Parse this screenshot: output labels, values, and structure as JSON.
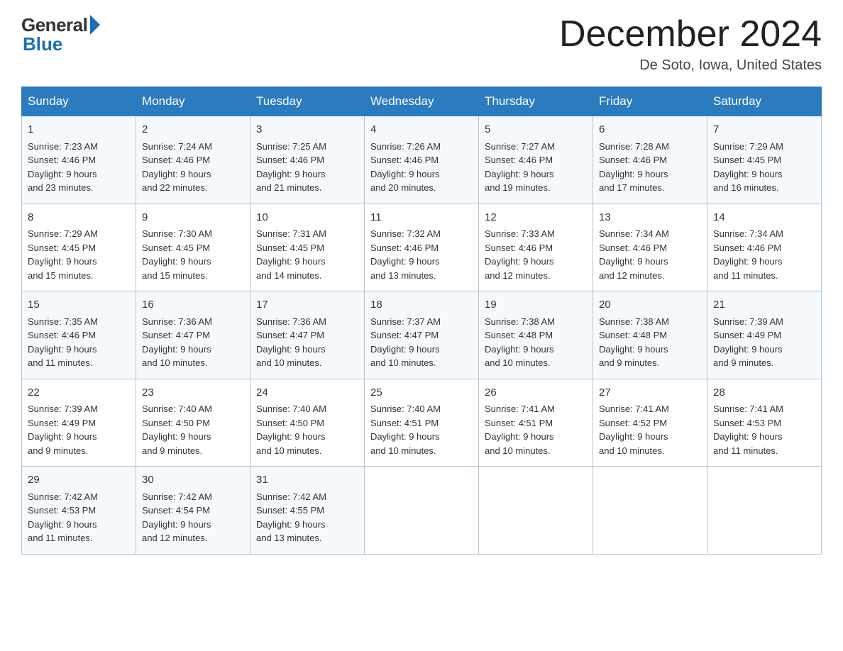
{
  "header": {
    "logo_general": "General",
    "logo_blue": "Blue",
    "title": "December 2024",
    "location": "De Soto, Iowa, United States"
  },
  "days_of_week": [
    "Sunday",
    "Monday",
    "Tuesday",
    "Wednesday",
    "Thursday",
    "Friday",
    "Saturday"
  ],
  "weeks": [
    [
      {
        "day": "1",
        "sunrise": "7:23 AM",
        "sunset": "4:46 PM",
        "daylight": "9 hours and 23 minutes."
      },
      {
        "day": "2",
        "sunrise": "7:24 AM",
        "sunset": "4:46 PM",
        "daylight": "9 hours and 22 minutes."
      },
      {
        "day": "3",
        "sunrise": "7:25 AM",
        "sunset": "4:46 PM",
        "daylight": "9 hours and 21 minutes."
      },
      {
        "day": "4",
        "sunrise": "7:26 AM",
        "sunset": "4:46 PM",
        "daylight": "9 hours and 20 minutes."
      },
      {
        "day": "5",
        "sunrise": "7:27 AM",
        "sunset": "4:46 PM",
        "daylight": "9 hours and 19 minutes."
      },
      {
        "day": "6",
        "sunrise": "7:28 AM",
        "sunset": "4:46 PM",
        "daylight": "9 hours and 17 minutes."
      },
      {
        "day": "7",
        "sunrise": "7:29 AM",
        "sunset": "4:45 PM",
        "daylight": "9 hours and 16 minutes."
      }
    ],
    [
      {
        "day": "8",
        "sunrise": "7:29 AM",
        "sunset": "4:45 PM",
        "daylight": "9 hours and 15 minutes."
      },
      {
        "day": "9",
        "sunrise": "7:30 AM",
        "sunset": "4:45 PM",
        "daylight": "9 hours and 15 minutes."
      },
      {
        "day": "10",
        "sunrise": "7:31 AM",
        "sunset": "4:45 PM",
        "daylight": "9 hours and 14 minutes."
      },
      {
        "day": "11",
        "sunrise": "7:32 AM",
        "sunset": "4:46 PM",
        "daylight": "9 hours and 13 minutes."
      },
      {
        "day": "12",
        "sunrise": "7:33 AM",
        "sunset": "4:46 PM",
        "daylight": "9 hours and 12 minutes."
      },
      {
        "day": "13",
        "sunrise": "7:34 AM",
        "sunset": "4:46 PM",
        "daylight": "9 hours and 12 minutes."
      },
      {
        "day": "14",
        "sunrise": "7:34 AM",
        "sunset": "4:46 PM",
        "daylight": "9 hours and 11 minutes."
      }
    ],
    [
      {
        "day": "15",
        "sunrise": "7:35 AM",
        "sunset": "4:46 PM",
        "daylight": "9 hours and 11 minutes."
      },
      {
        "day": "16",
        "sunrise": "7:36 AM",
        "sunset": "4:47 PM",
        "daylight": "9 hours and 10 minutes."
      },
      {
        "day": "17",
        "sunrise": "7:36 AM",
        "sunset": "4:47 PM",
        "daylight": "9 hours and 10 minutes."
      },
      {
        "day": "18",
        "sunrise": "7:37 AM",
        "sunset": "4:47 PM",
        "daylight": "9 hours and 10 minutes."
      },
      {
        "day": "19",
        "sunrise": "7:38 AM",
        "sunset": "4:48 PM",
        "daylight": "9 hours and 10 minutes."
      },
      {
        "day": "20",
        "sunrise": "7:38 AM",
        "sunset": "4:48 PM",
        "daylight": "9 hours and 9 minutes."
      },
      {
        "day": "21",
        "sunrise": "7:39 AM",
        "sunset": "4:49 PM",
        "daylight": "9 hours and 9 minutes."
      }
    ],
    [
      {
        "day": "22",
        "sunrise": "7:39 AM",
        "sunset": "4:49 PM",
        "daylight": "9 hours and 9 minutes."
      },
      {
        "day": "23",
        "sunrise": "7:40 AM",
        "sunset": "4:50 PM",
        "daylight": "9 hours and 9 minutes."
      },
      {
        "day": "24",
        "sunrise": "7:40 AM",
        "sunset": "4:50 PM",
        "daylight": "9 hours and 10 minutes."
      },
      {
        "day": "25",
        "sunrise": "7:40 AM",
        "sunset": "4:51 PM",
        "daylight": "9 hours and 10 minutes."
      },
      {
        "day": "26",
        "sunrise": "7:41 AM",
        "sunset": "4:51 PM",
        "daylight": "9 hours and 10 minutes."
      },
      {
        "day": "27",
        "sunrise": "7:41 AM",
        "sunset": "4:52 PM",
        "daylight": "9 hours and 10 minutes."
      },
      {
        "day": "28",
        "sunrise": "7:41 AM",
        "sunset": "4:53 PM",
        "daylight": "9 hours and 11 minutes."
      }
    ],
    [
      {
        "day": "29",
        "sunrise": "7:42 AM",
        "sunset": "4:53 PM",
        "daylight": "9 hours and 11 minutes."
      },
      {
        "day": "30",
        "sunrise": "7:42 AM",
        "sunset": "4:54 PM",
        "daylight": "9 hours and 12 minutes."
      },
      {
        "day": "31",
        "sunrise": "7:42 AM",
        "sunset": "4:55 PM",
        "daylight": "9 hours and 13 minutes."
      },
      null,
      null,
      null,
      null
    ]
  ],
  "labels": {
    "sunrise": "Sunrise:",
    "sunset": "Sunset:",
    "daylight": "Daylight:"
  }
}
